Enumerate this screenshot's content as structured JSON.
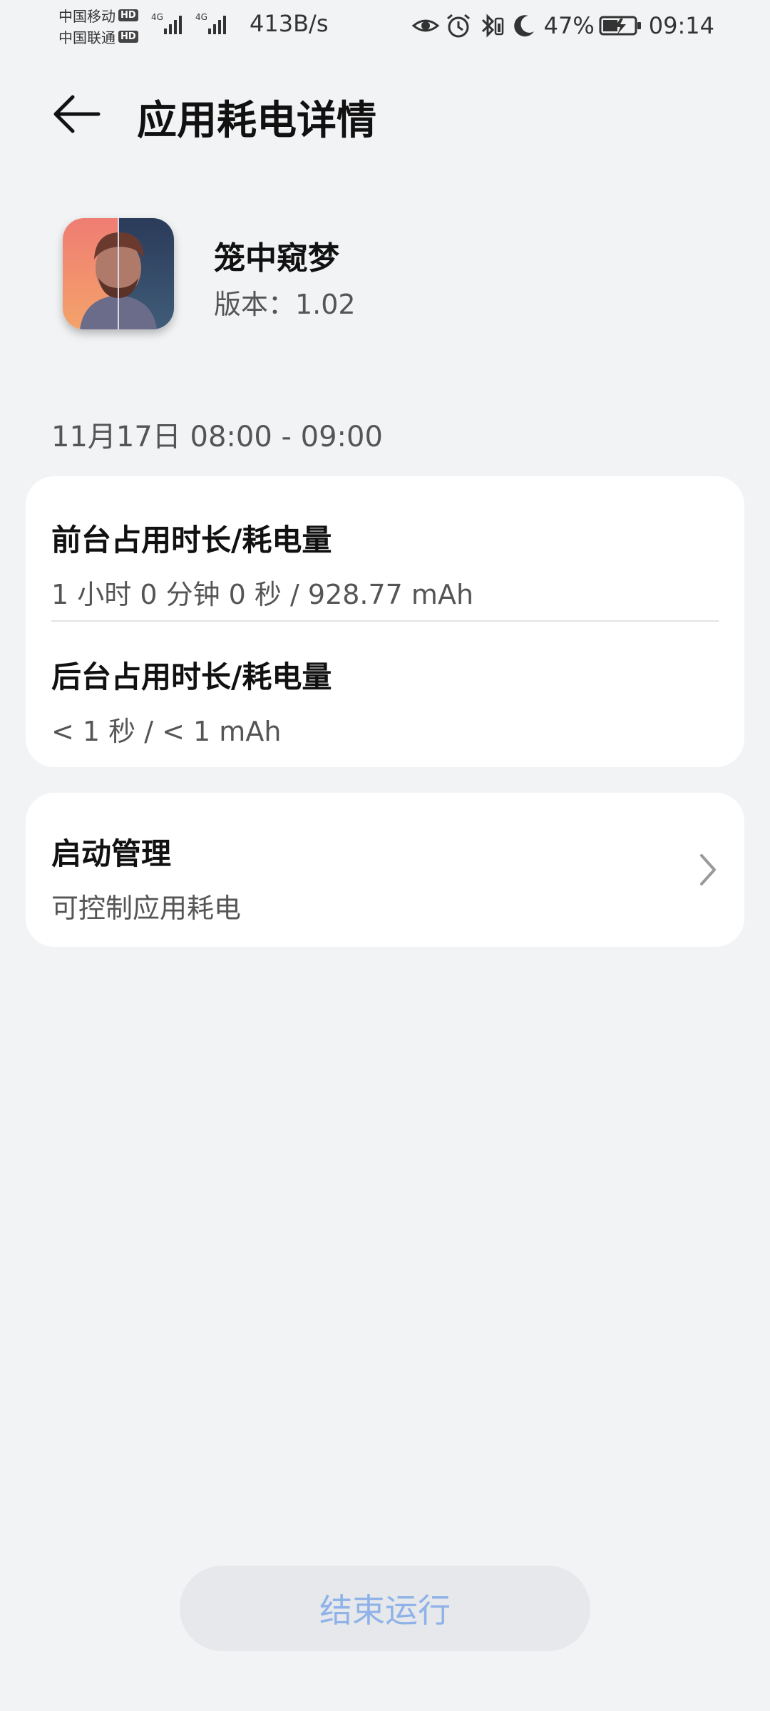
{
  "status_bar": {
    "carrier_1": "中国移动",
    "carrier_2": "中国联通",
    "hd_badge": "HD",
    "network_type": "4G",
    "net_speed": "413B/s",
    "battery_percent": "47%",
    "time": "09:14"
  },
  "header": {
    "title": "应用耗电详情"
  },
  "app": {
    "name": "笼中窥梦",
    "version": "版本：1.02"
  },
  "time_range": "11月17日 08:00 - 09:00",
  "usage": {
    "foreground": {
      "title": "前台占用时长/耗电量",
      "value": "1 小时 0 分钟 0 秒 / 928.77 mAh"
    },
    "background": {
      "title": "后台占用时长/耗电量",
      "value": "< 1 秒 / < 1 mAh"
    }
  },
  "startup": {
    "title": "启动管理",
    "subtitle": "可控制应用耗电"
  },
  "end_button_label": "结束运行",
  "colors": {
    "background": "#f1f3f5",
    "card": "#ffffff",
    "button_text_disabled": "#8fb2e8"
  }
}
